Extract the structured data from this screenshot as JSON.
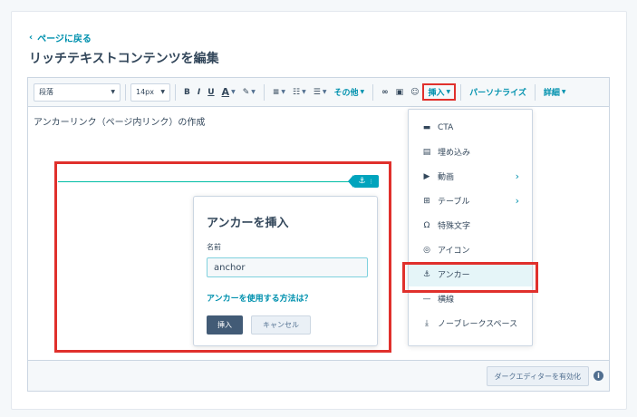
{
  "nav": {
    "back_label": "ページに戻る"
  },
  "page": {
    "title": "リッチテキストコンテンツを編集"
  },
  "toolbar": {
    "paragraph_style": "段落",
    "font_size": "14px",
    "bold": "B",
    "italic": "I",
    "underline": "U",
    "text_color": "A",
    "more_label": "その他",
    "insert_label": "挿入",
    "personalize_label": "パーソナライズ",
    "details_label": "詳細"
  },
  "content": {
    "text": "アンカーリンク（ページ内リンク）の作成"
  },
  "insert_menu": {
    "items": [
      {
        "label": "CTA",
        "icon": "cta-icon"
      },
      {
        "label": "埋め込み",
        "icon": "embed-icon"
      },
      {
        "label": "動画",
        "icon": "video-icon",
        "submenu": true
      },
      {
        "label": "テーブル",
        "icon": "table-icon",
        "submenu": true
      },
      {
        "label": "特殊文字",
        "icon": "omega-icon"
      },
      {
        "label": "アイコン",
        "icon": "icon-icon"
      },
      {
        "label": "アンカー",
        "icon": "anchor-icon"
      },
      {
        "label": "横線",
        "icon": "horizontal-line-icon"
      },
      {
        "label": "ノーブレークスペース",
        "icon": "nbsp-icon"
      }
    ]
  },
  "anchor_dialog": {
    "title": "アンカーを挿入",
    "name_label": "名前",
    "name_value": "anchor",
    "help_link": "アンカーを使用する方法は？",
    "insert_button": "挿入",
    "cancel_button": "キャンセル"
  },
  "footer": {
    "dark_editor_button": "ダークエディターを有効化"
  },
  "colors": {
    "accent": "#0091ae",
    "highlight_red": "#e0302c",
    "primary_button": "#425b76",
    "anchor_marker": "#00a4bd"
  }
}
